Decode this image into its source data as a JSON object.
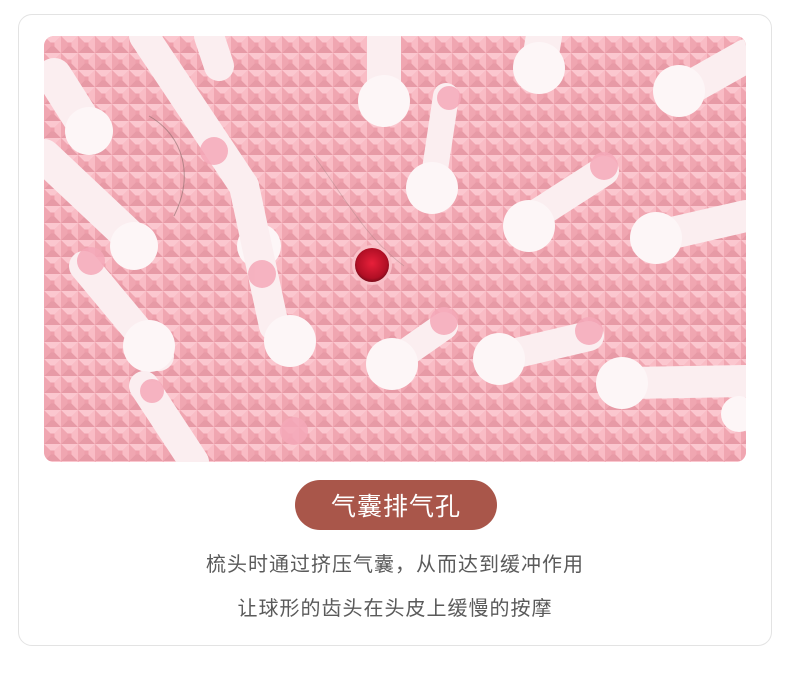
{
  "image": {
    "subject": "airbag-vent-hole-closeup-icon",
    "colors": {
      "cushion": "#f6b2bc",
      "bristle": "#fcf3f4",
      "bristle_tip": "#f4a8b8",
      "hole": "#c0122b"
    }
  },
  "label": {
    "title": "气囊排气孔"
  },
  "description": {
    "line1": "梳头时通过挤压气囊，从而达到缓冲作用",
    "line2": "让球形的齿头在头皮上缓慢的按摩"
  }
}
